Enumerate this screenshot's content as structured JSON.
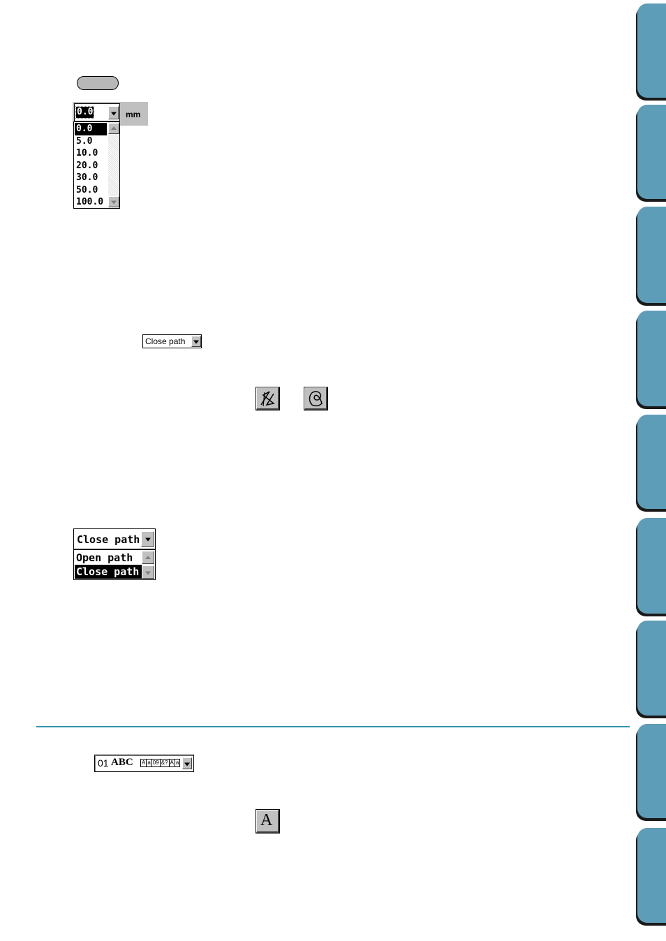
{
  "width_combo": {
    "value": "0.0",
    "unit": "mm",
    "options": [
      "0.0",
      "5.0",
      "10.0",
      "20.0",
      "30.0",
      "50.0",
      "100.0"
    ],
    "selected": "0.0"
  },
  "path_combo_small": {
    "value": "Close path"
  },
  "path_combo_open": {
    "value": "Close path",
    "options": [
      "Open path",
      "Close path"
    ],
    "selected": "Close path"
  },
  "font_combo": {
    "number": "01",
    "sample": "ABC",
    "badges": [
      "A",
      "a",
      "09",
      "&?",
      "A",
      "a"
    ]
  },
  "text_tool": {
    "glyph": "A"
  },
  "colors": {
    "tab": "#5e9db8",
    "rule": "#2e96a8"
  }
}
